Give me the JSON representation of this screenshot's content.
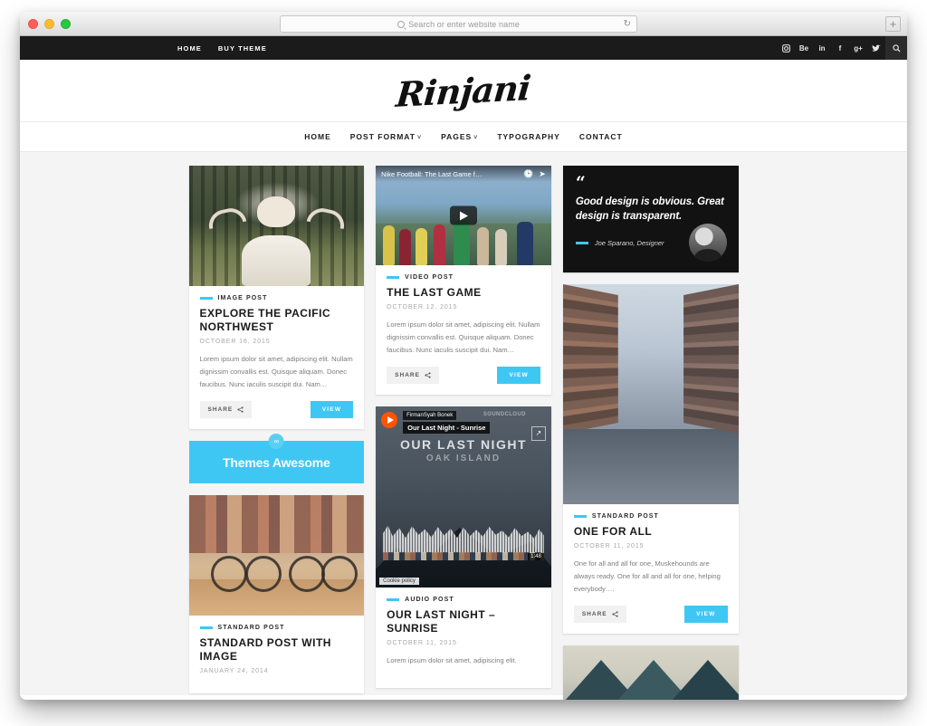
{
  "browser": {
    "address_placeholder": "Search or enter website name",
    "search_icon": "search-icon",
    "reload_icon": "reload-icon",
    "newtab_label": "+",
    "traffic_lights": [
      "close",
      "minimize",
      "zoom"
    ]
  },
  "topbar": {
    "links": [
      {
        "label": "HOME"
      },
      {
        "label": "BUY THEME"
      }
    ],
    "social": [
      {
        "name": "instagram",
        "glyph": "▣"
      },
      {
        "name": "behance",
        "glyph": "Be"
      },
      {
        "name": "linkedin",
        "glyph": "in"
      },
      {
        "name": "facebook",
        "glyph": "f"
      },
      {
        "name": "google-plus",
        "glyph": "g+"
      },
      {
        "name": "twitter",
        "glyph": "✈"
      },
      {
        "name": "search",
        "glyph": "⌕"
      }
    ]
  },
  "site": {
    "logo": "Rinjani",
    "accent_color": "#3FC7F4",
    "nav": [
      {
        "label": "HOME",
        "has_dropdown": false
      },
      {
        "label": "POST FORMAT",
        "has_dropdown": true
      },
      {
        "label": "PAGES",
        "has_dropdown": true
      },
      {
        "label": "TYPOGRAPHY",
        "has_dropdown": false
      },
      {
        "label": "CONTACT",
        "has_dropdown": false
      }
    ],
    "caret": "˅"
  },
  "buttons": {
    "share": "SHARE",
    "view": "VIEW",
    "share_icon": "share-icon"
  },
  "promo": {
    "text": "Themes Awesome",
    "icon": "link-icon",
    "icon_glyph": "∞"
  },
  "quote": {
    "mark": "“",
    "text": "Good design is obvious. Great design is transparent.",
    "author": "Joe Sparano, Designer"
  },
  "youtube": {
    "title": "Nike Football: The Last Game f…",
    "watch_later_icon": "clock-icon",
    "share_icon": "share-arrow-icon",
    "play_icon": "play-icon"
  },
  "soundcloud": {
    "user": "FirmanSyah Bonek",
    "track": "Our Last Night - Sunrise",
    "artwork_title": "OUR LAST NIGHT",
    "artwork_subtitle": "OAK ISLAND",
    "brand": "SOUNDCLOUD",
    "duration": "1:48",
    "cookie_policy": "Cookie policy",
    "play_icon": "play-icon",
    "share_icon": "share-icon"
  },
  "posts": [
    {
      "category": "IMAGE POST",
      "title": "EXPLORE THE PACIFIC NORTHWEST",
      "date": "OCTOBER 16, 2015",
      "excerpt": "Lorem ipsum dolor sit amet,  adipiscing elit. Nullam dignissim convallis est. Quisque aliquam. Donec faucibus. Nunc iaculis suscipit dui. Nam…"
    },
    {
      "category": "STANDARD POST",
      "title": "STANDARD POST WITH IMAGE",
      "date": "JANUARY 24, 2014"
    },
    {
      "category": "VIDEO POST",
      "title": "THE LAST GAME",
      "date": "OCTOBER 12, 2015",
      "excerpt": "Lorem ipsum dolor sit amet,  adipiscing elit. Nullam dignissim convallis est. Quisque aliquam. Donec faucibus. Nunc iaculis suscipit dui. Nam…"
    },
    {
      "category": "AUDIO POST",
      "title": "OUR LAST NIGHT – SUNRISE",
      "date": "OCTOBER 11, 2015",
      "excerpt": "Lorem ipsum dolor sit amet,  adipiscing elit."
    },
    {
      "category": "STANDARD POST",
      "title": "ONE FOR ALL",
      "date": "OCTOBER 11, 2015",
      "excerpt": "One for all and all for one, Muskehounds are always ready. One for all and all for one, helping everybody…."
    }
  ]
}
